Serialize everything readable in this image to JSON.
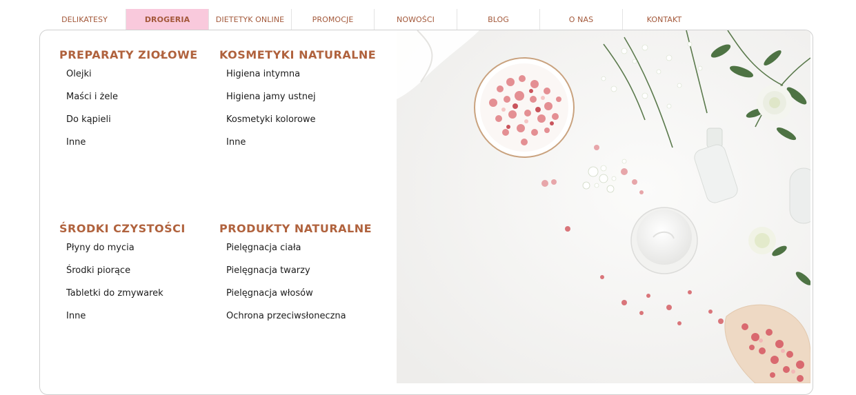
{
  "nav": {
    "items": [
      {
        "label": "DELIKATESY"
      },
      {
        "label": "DROGERIA"
      },
      {
        "label": "DIETETYK ONLINE"
      },
      {
        "label": "PROMOCJE"
      },
      {
        "label": "NOWOŚCI"
      },
      {
        "label": "BLOG"
      },
      {
        "label": "O NAS"
      },
      {
        "label": "KONTAKT"
      }
    ],
    "active_index": 1,
    "active_color": "#f9c9dc",
    "text_color": "#a3583a"
  },
  "menu": {
    "title_color": "#b0623d",
    "groups": [
      {
        "title": "PREPARATY ZIOŁOWE",
        "items": [
          "Olejki",
          "Maści i żele",
          "Do kąpieli",
          "Inne"
        ]
      },
      {
        "title": "KOSMETYKI NATURALNE",
        "items": [
          "Higiena intymna",
          "Higiena jamy ustnej",
          "Kosmetyki kolorowe",
          "Inne"
        ]
      },
      {
        "title": "ŚRODKI CZYSTOŚCI",
        "items": [
          "Płyny do mycia",
          "Środki piorące",
          "Tabletki do zmywarek",
          "Inne"
        ]
      },
      {
        "title": "PRODUKTY NATURALNE",
        "items": [
          "Pielęgnacja ciała",
          "Pielęgnacja twarzy",
          "Pielęgnacja włosów",
          "Ochrona przeciwsłoneczna"
        ]
      }
    ]
  },
  "photo": {
    "icon": "cosmetics-photo",
    "accent_color": "#d9757a"
  }
}
